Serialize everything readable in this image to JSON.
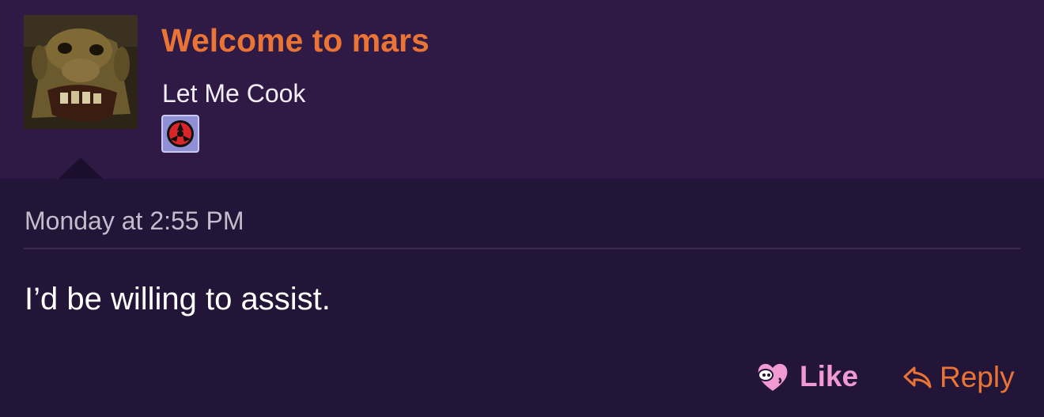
{
  "user": {
    "name": "Welcome to mars",
    "title": "Let Me Cook",
    "avatar_icon": "ogre-face-avatar",
    "badge_icon": "red-emblem-badge-icon"
  },
  "post": {
    "timestamp": "Monday at 2:55 PM",
    "message": "I’d be willing to assist."
  },
  "actions": {
    "like_label": "Like",
    "like_icon": "heart-face-icon",
    "reply_label": "Reply",
    "reply_icon": "reply-arrow-icon"
  },
  "colors": {
    "username": "#ea7436",
    "like": "#f19ad2",
    "reply": "#ea7436",
    "header_bg": "#2e1a45",
    "body_bg": "#231537"
  }
}
